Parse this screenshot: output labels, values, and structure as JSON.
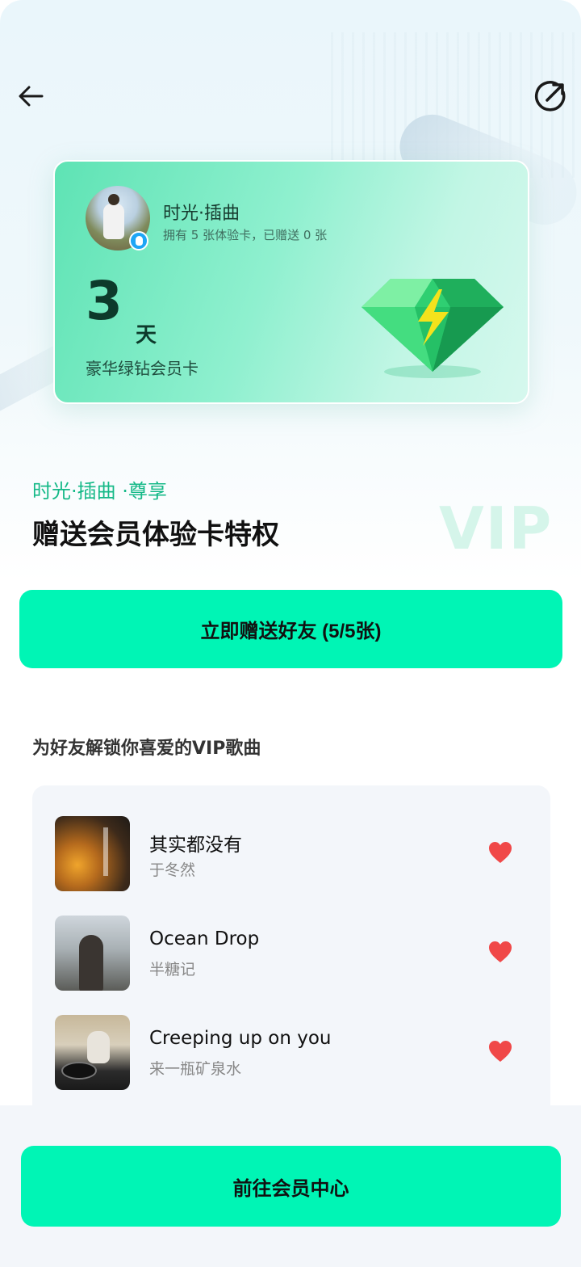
{
  "header": {
    "back_icon": "arrow-left-icon",
    "share_icon": "share-out-icon"
  },
  "card": {
    "user_name": "时光·插曲",
    "status": "拥有 5 张体验卡，已赠送 0 张",
    "days": "3",
    "days_unit": "天",
    "card_type": "豪华绿钻会员卡",
    "badge_icon": "qq-badge-icon",
    "emblem_icon": "green-diamond-icon"
  },
  "promo": {
    "subtitle": "时光·插曲 ·尊享",
    "title": "赠送会员体验卡特权",
    "watermark": "VIP"
  },
  "actions": {
    "gift_button": "立即赠送好友 (5/5张)",
    "member_center_button": "前往会员中心"
  },
  "songs_section": {
    "label": "为好友解锁你喜爱的VIP歌曲",
    "songs": [
      {
        "title": "其实都没有",
        "artist": "于冬然",
        "liked": true
      },
      {
        "title": "Ocean Drop",
        "artist": "半糖记",
        "liked": true
      },
      {
        "title": "Creeping up on you",
        "artist": "来一瓶矿泉水",
        "liked": true
      }
    ]
  },
  "colors": {
    "accent": "#00f5b5",
    "accent_text": "#16b988",
    "heart": "#f04848",
    "card_gradient_start": "#5ee3b4"
  }
}
